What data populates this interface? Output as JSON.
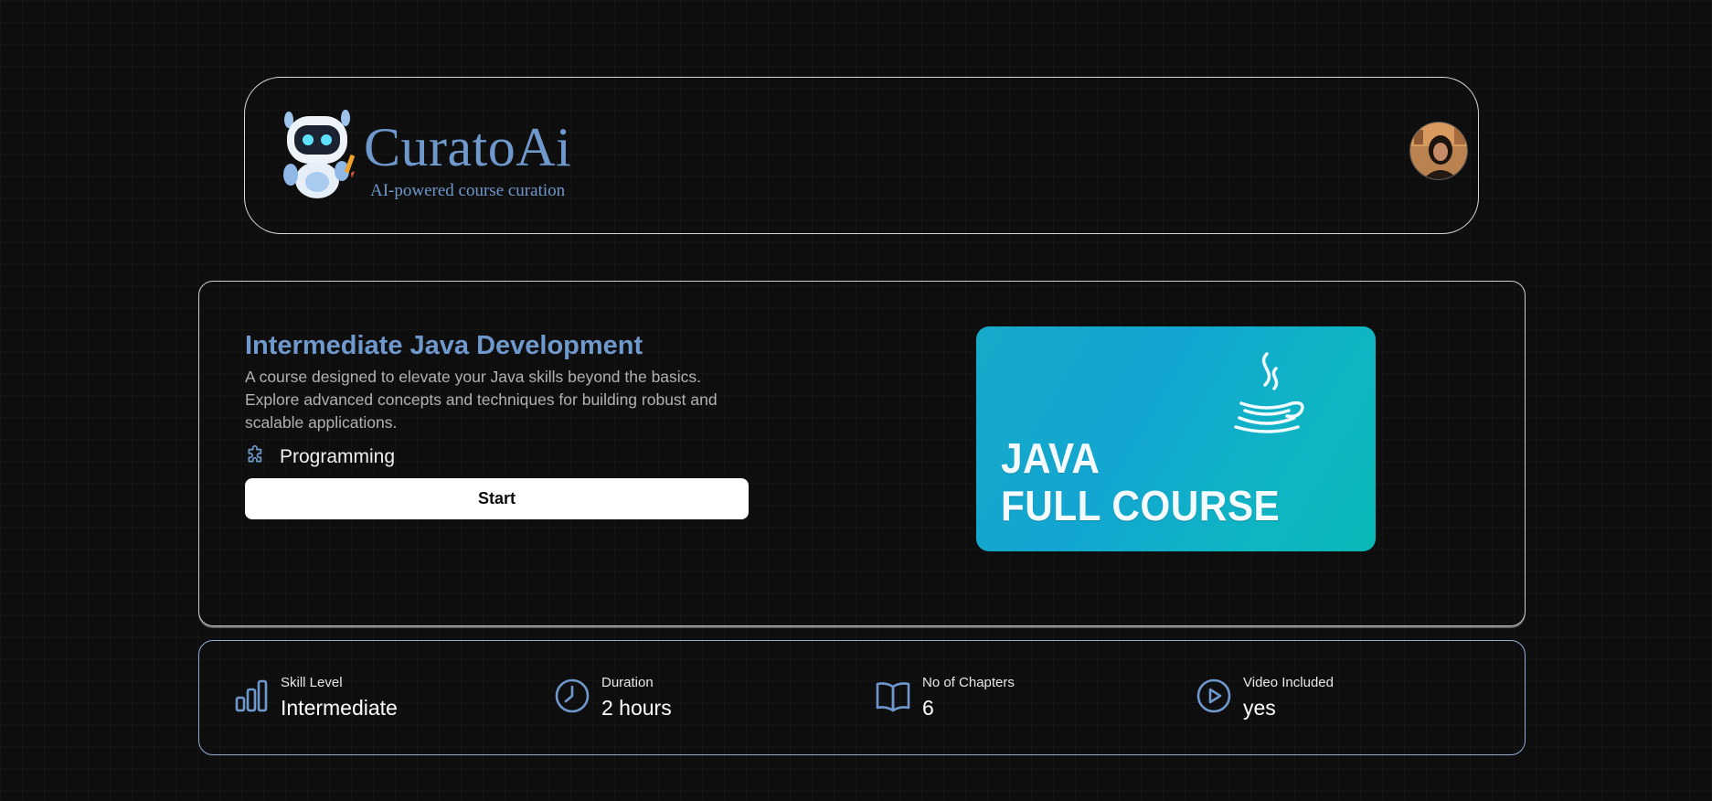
{
  "header": {
    "brand_name": "CuratoAi",
    "tagline": "AI-powered course curation",
    "logo_icon": "robot-mascot-icon",
    "avatar": "user-avatar"
  },
  "course": {
    "title": "Intermediate Java Development",
    "description": "A course designed to elevate your Java skills beyond the basics. Explore advanced concepts and techniques for building robust and scalable applications.",
    "category_icon": "puzzle-icon",
    "category": "Programming",
    "start_label": "Start",
    "banner": {
      "line1": "JAVA",
      "line2": "FULL COURSE",
      "icon": "java-coffee-cup-icon"
    }
  },
  "stats": [
    {
      "icon": "bar-chart-icon",
      "label": "Skill Level",
      "value": "Intermediate"
    },
    {
      "icon": "clock-icon",
      "label": "Duration",
      "value": "2 hours"
    },
    {
      "icon": "book-open-icon",
      "label": "No of Chapters",
      "value": "6"
    },
    {
      "icon": "play-circle-icon",
      "label": "Video Included",
      "value": "yes"
    }
  ],
  "colors": {
    "accent": "#6f98cc",
    "background": "#0e0e0f",
    "banner": "#12a6d1"
  }
}
